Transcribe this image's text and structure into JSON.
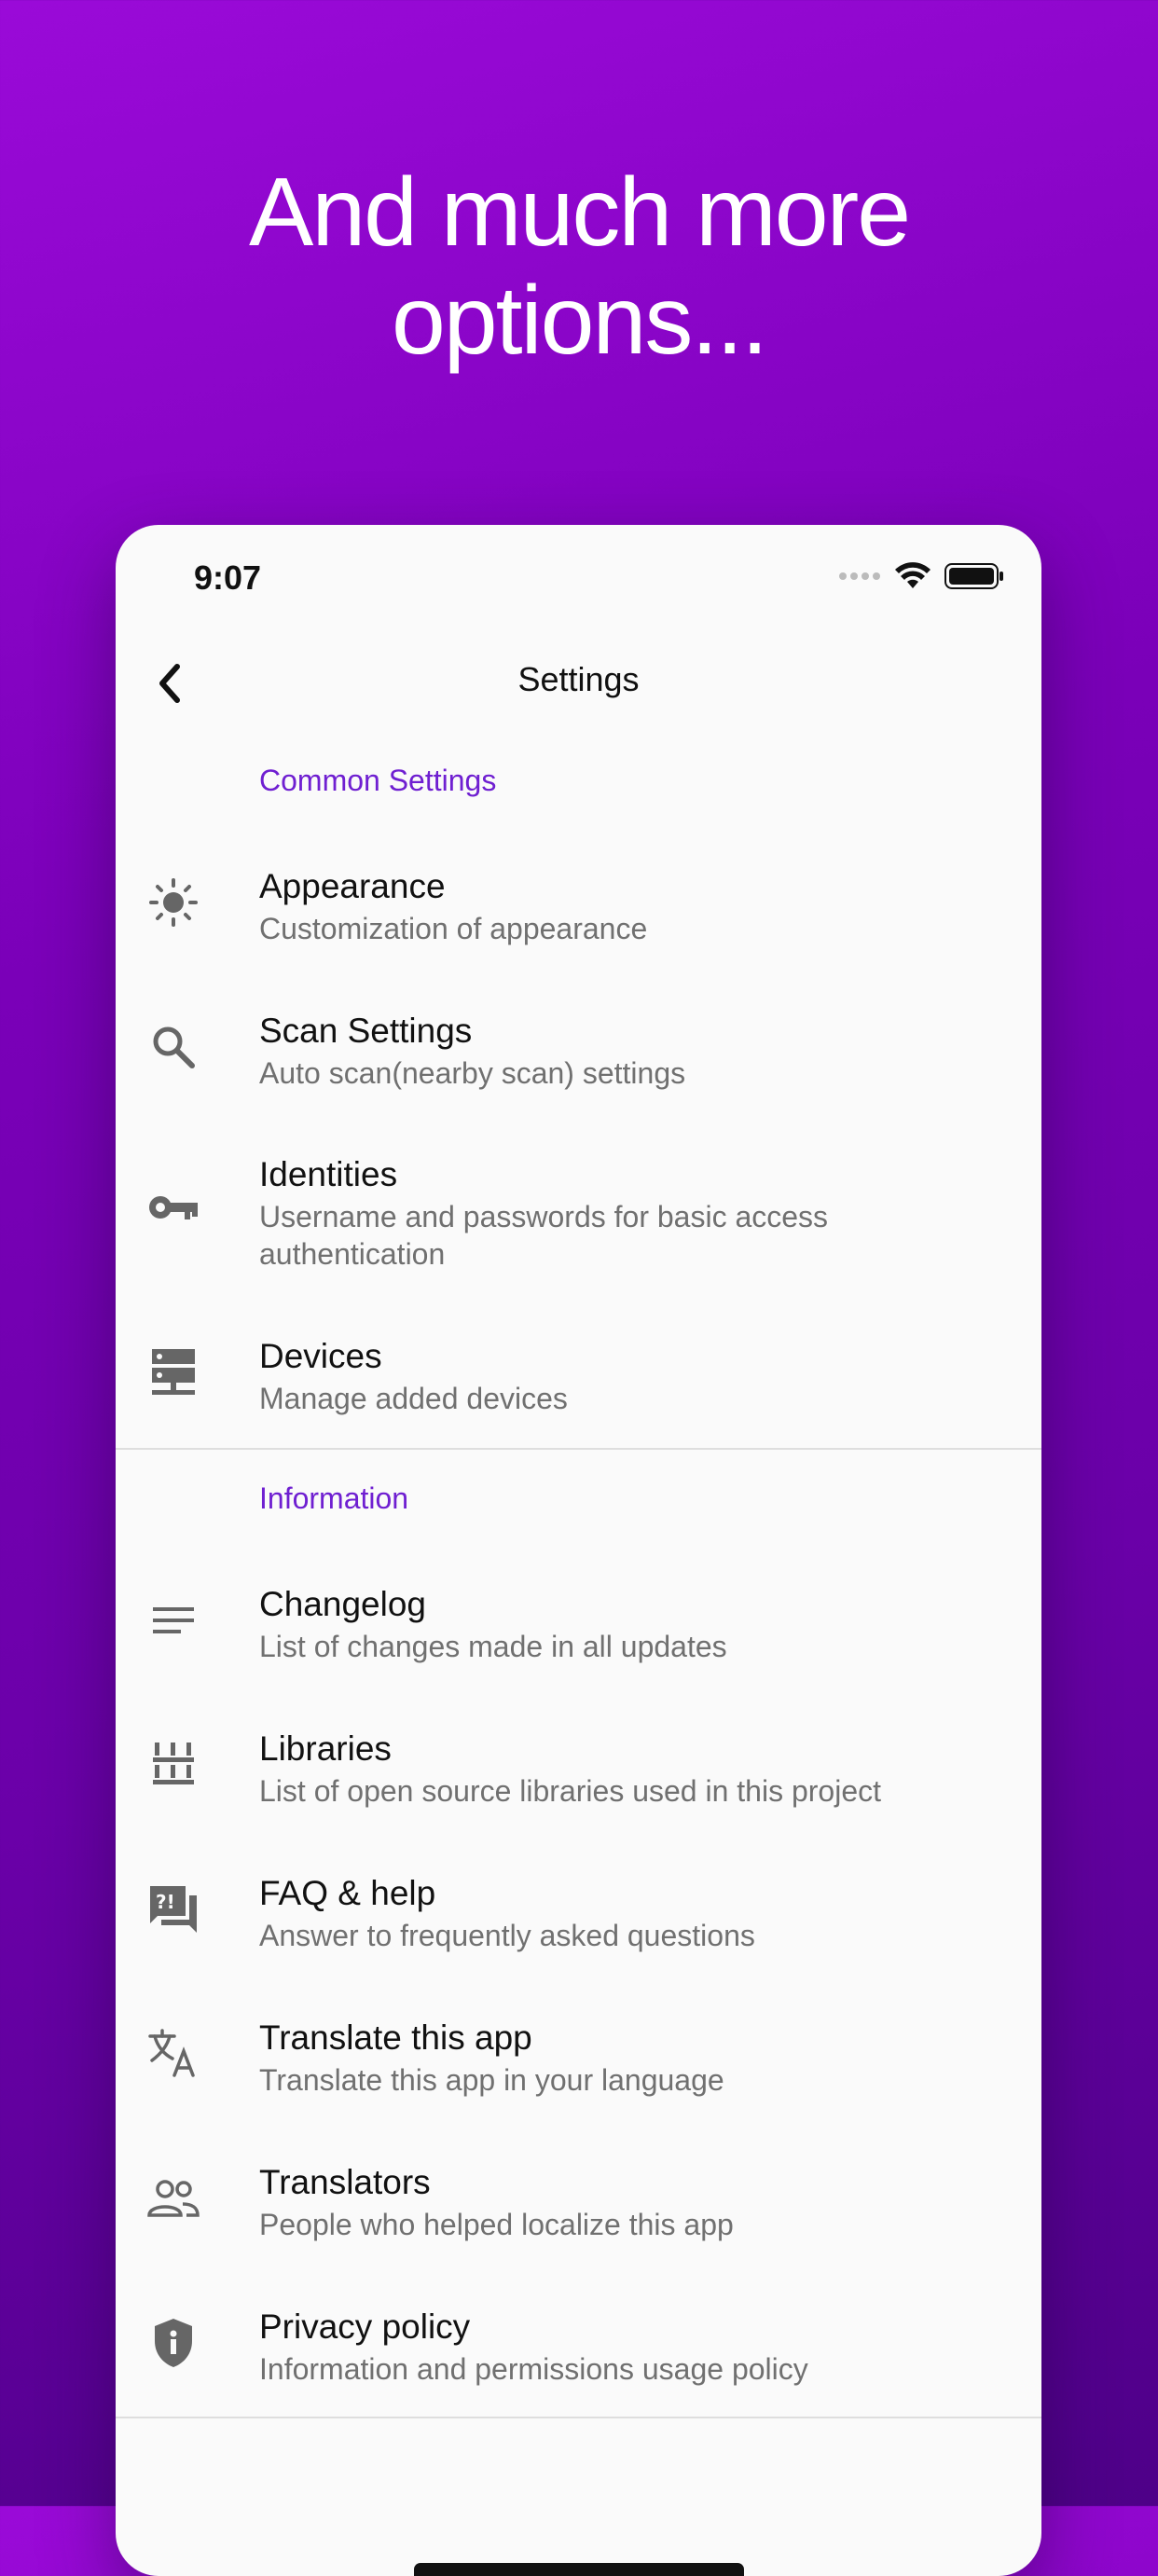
{
  "headline": {
    "line1": "And much more",
    "line2": "options..."
  },
  "status_bar": {
    "time": "9:07"
  },
  "nav": {
    "title": "Settings"
  },
  "sections": {
    "common": "Common Settings",
    "information": "Information"
  },
  "items": [
    {
      "label": "Appearance",
      "sub": "Customization of appearance",
      "icon": "brightness-icon"
    },
    {
      "label": "Scan Settings",
      "sub": "Auto scan(nearby scan) settings",
      "icon": "search-icon"
    },
    {
      "label": "Identities",
      "sub": "Username and passwords for basic access authentication",
      "icon": "key-icon"
    },
    {
      "label": "Devices",
      "sub": "Manage added devices",
      "icon": "dns-icon"
    },
    {
      "label": "Changelog",
      "sub": "List of changes made in all updates",
      "icon": "notes-icon"
    },
    {
      "label": "Libraries",
      "sub": "List of open source libraries used in this project",
      "icon": "library-icon"
    },
    {
      "label": "FAQ & help",
      "sub": "Answer to frequently asked questions",
      "icon": "help-chat-icon"
    },
    {
      "label": "Translate this app",
      "sub": "Translate this app in your language",
      "icon": "translate-icon"
    },
    {
      "label": "Translators",
      "sub": "People who helped localize this app",
      "icon": "people-icon"
    },
    {
      "label": "Privacy policy",
      "sub": "Information and permissions usage policy",
      "icon": "shield-info-icon"
    }
  ],
  "colors": {
    "accent": "#6f1fd1",
    "background_gradient": [
      "#9a0ad8",
      "#4e0088"
    ],
    "icon": "#666666"
  }
}
